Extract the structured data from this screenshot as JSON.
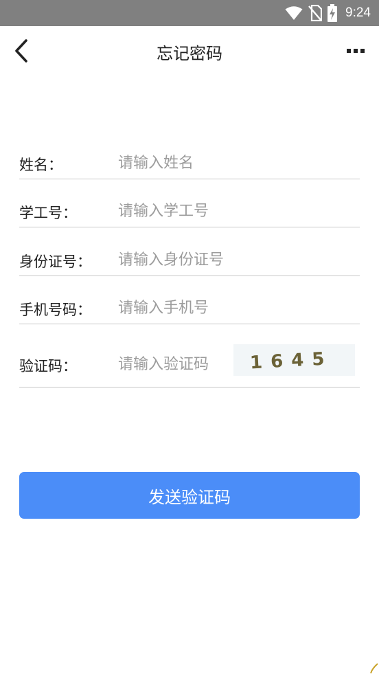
{
  "status_bar": {
    "time": "9:24",
    "icons": [
      "wifi-icon",
      "no-sim-icon",
      "battery-charging-icon"
    ]
  },
  "header": {
    "title": "忘记密码",
    "back_icon": "chevron-left-icon",
    "more_icon": "more-horizontal-icon"
  },
  "form": {
    "name": {
      "label": "姓名：",
      "placeholder": "请输入姓名"
    },
    "student_id": {
      "label": "学工号：",
      "placeholder": "请输入学工号"
    },
    "id_card": {
      "label": "身份证号：",
      "placeholder": "请输入身份证号"
    },
    "phone": {
      "label": "手机号码：",
      "placeholder": "请输入手机号"
    },
    "captcha": {
      "label": "验证码：",
      "placeholder": "请输入验证码",
      "code": "1645"
    }
  },
  "actions": {
    "send_code_label": "发送验证码"
  },
  "colors": {
    "status_bar": "#808080",
    "primary_button": "#4b8df8",
    "divider": "#c8c8c8",
    "placeholder": "#9c9c9c",
    "captcha_text": "#6b6237"
  }
}
